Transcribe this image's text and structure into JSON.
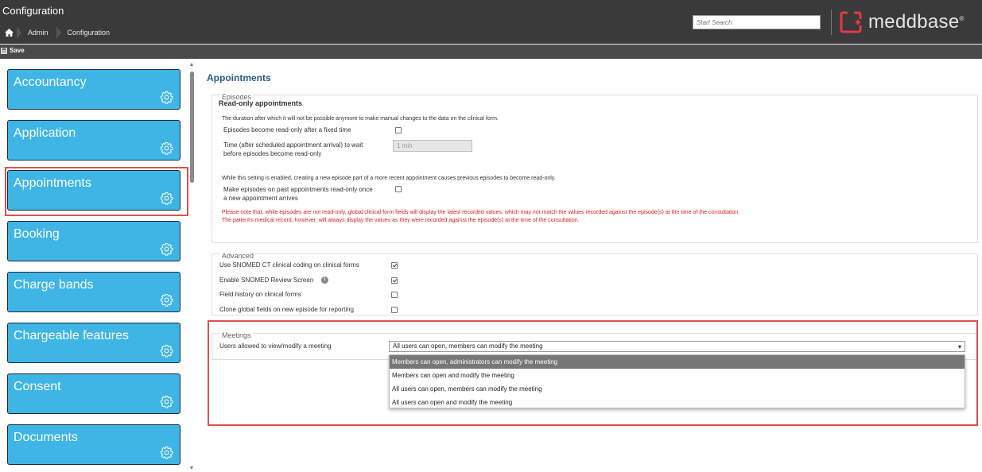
{
  "header": {
    "title": "Configuration",
    "breadcrumbs": [
      "Admin",
      "Configuration"
    ],
    "search_placeholder": "Start Search",
    "logo_text": "meddbase",
    "logo_mark": "®"
  },
  "toolbar": {
    "save_label": "Save"
  },
  "sidebar": {
    "items": [
      {
        "label": "Accountancy"
      },
      {
        "label": "Application"
      },
      {
        "label": "Appointments"
      },
      {
        "label": "Booking"
      },
      {
        "label": "Charge bands"
      },
      {
        "label": "Chargeable features"
      },
      {
        "label": "Consent"
      },
      {
        "label": "Documents"
      }
    ],
    "selected": "Appointments"
  },
  "main": {
    "title": "Appointments",
    "episodes": {
      "legend": "Episodes",
      "heading": "Read-only appointments",
      "intro": "The duration after which it will not be possible anymore to make manual changes to the data on the clinical form.",
      "readonly_fixed_label": "Episodes become read-only after a fixed time",
      "readonly_fixed_checked": false,
      "wait_label_1": "Time (after scheduled appointment arrival) to wait",
      "wait_label_2": "before episodes become read-only",
      "wait_value": "1 min",
      "enabled_note": "While this setting is enabled, creating a new episode part of a more recent appointment causes previous episodes to become read-only.",
      "past_label_1": "Make episodes on past appointments read-only once",
      "past_label_2": "a new appointment arrives",
      "past_checked": false,
      "warning_1": "Please note that, while episodes are not read-only, global clinical form fields will display the latest recorded values, which may not match the values recorded against the episode(s) at the time of the consultation.",
      "warning_2": "The patient's medical record, however, will always display the values as they were recorded against the episode(s) at the time of the consultation."
    },
    "advanced": {
      "legend": "Advanced",
      "rows": [
        {
          "label": "Use SNOMED CT clinical coding on clinical forms",
          "checked": true
        },
        {
          "label": "Enable SNOMED Review Screen",
          "checked": true
        },
        {
          "label": "Field history on clinical forms",
          "checked": false
        },
        {
          "label": "Clone global fields on new episode for reporting",
          "checked": false
        }
      ],
      "info_glyph": "i"
    },
    "meetings": {
      "legend": "Meetings",
      "label": "Users allowed to view/modify a meeting",
      "selected_value": "All users can open, members can modify the meeting",
      "options": [
        "Members can open, administrators can modify the meeting",
        "Members can open and modify the meeting",
        "All users can open, members can modify the meeting",
        "All users can open and modify the meeting"
      ],
      "highlighted_option": 0
    }
  },
  "colors": {
    "header_bg": "#3a3a3a",
    "tile_bg": "#3fb5e6",
    "accent_red": "#d9534f",
    "title_blue": "#2b5b87",
    "warning_red": "#e02020"
  }
}
